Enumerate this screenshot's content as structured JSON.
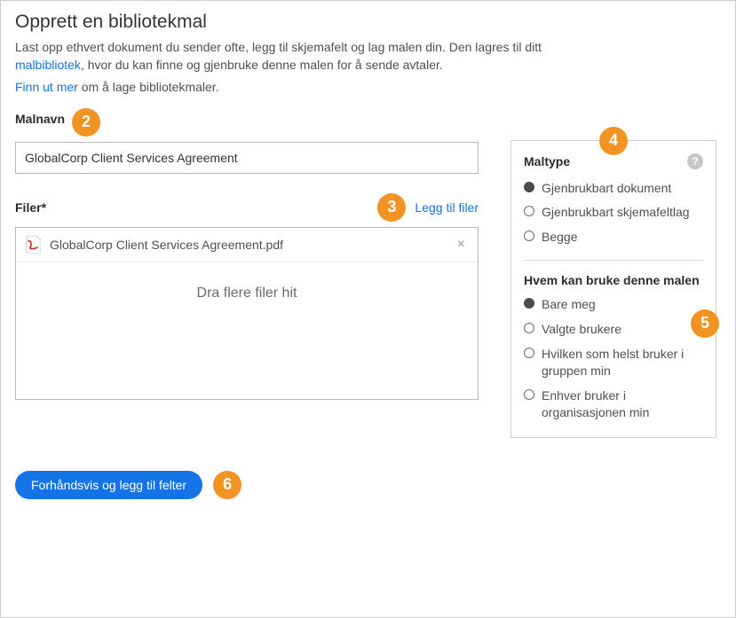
{
  "header": {
    "title": "Opprett en bibliotekmal",
    "intro_before": "Last opp ethvert dokument du sender ofte, legg til skjemafelt og lag malen din. Den lagres til ditt ",
    "intro_link": "malbibliotek",
    "intro_after": ", hvor du kan finne og gjenbruke denne malen for å sende avtaler.",
    "learn_more_link": "Finn ut mer",
    "learn_more_after": " om å lage bibliotekmaler."
  },
  "steps": {
    "s2": "2",
    "s3": "3",
    "s4": "4",
    "s5": "5",
    "s6": "6"
  },
  "template_name": {
    "label": "Malnavn",
    "value": "GlobalCorp Client Services Agreement"
  },
  "files": {
    "label": "Filer*",
    "add_link": "Legg til filer",
    "items": [
      {
        "name": "GlobalCorp Client Services Agreement.pdf"
      }
    ],
    "drop_text": "Dra flere filer hit"
  },
  "template_type": {
    "title": "Maltype",
    "options": [
      {
        "label": "Gjenbrukbart dokument",
        "selected": true
      },
      {
        "label": "Gjenbrukbart skjemafeltlag",
        "selected": false
      },
      {
        "label": "Begge",
        "selected": false
      }
    ]
  },
  "who_can_use": {
    "title": "Hvem kan bruke denne malen",
    "options": [
      {
        "label": "Bare meg",
        "selected": true
      },
      {
        "label": "Valgte brukere",
        "selected": false
      },
      {
        "label": "Hvilken som helst bruker i gruppen min",
        "selected": false
      },
      {
        "label": "Enhver bruker i organisasjonen min",
        "selected": false
      }
    ]
  },
  "primary_button": "Forhåndsvis og legg til felter",
  "icons": {
    "help": "?",
    "remove": "×"
  }
}
